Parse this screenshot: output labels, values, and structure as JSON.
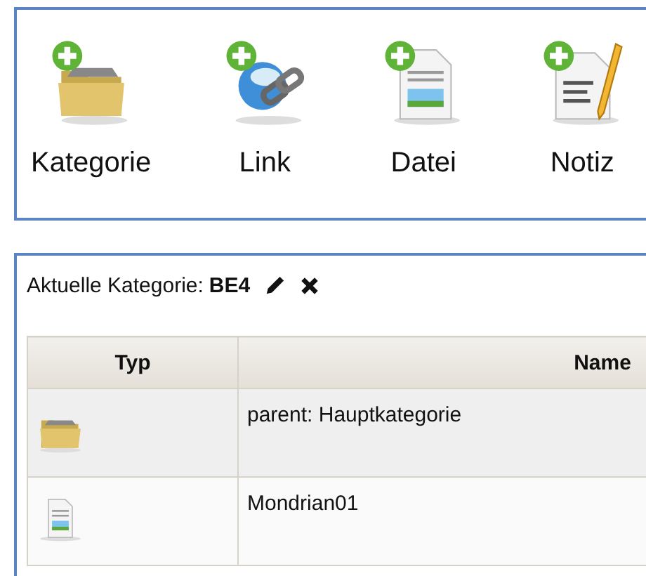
{
  "toolbar": {
    "items": [
      {
        "kind": "folder",
        "label": "Kategorie"
      },
      {
        "kind": "link",
        "label": "Link"
      },
      {
        "kind": "file",
        "label": "Datei"
      },
      {
        "kind": "note",
        "label": "Notiz"
      }
    ]
  },
  "category": {
    "label": "Aktuelle Kategorie:",
    "value": "BE4"
  },
  "table": {
    "columns": [
      "Typ",
      "Name"
    ],
    "rows": [
      {
        "kind": "folder",
        "name": "parent: Hauptkategorie"
      },
      {
        "kind": "file",
        "name": "Mondrian01"
      }
    ]
  }
}
